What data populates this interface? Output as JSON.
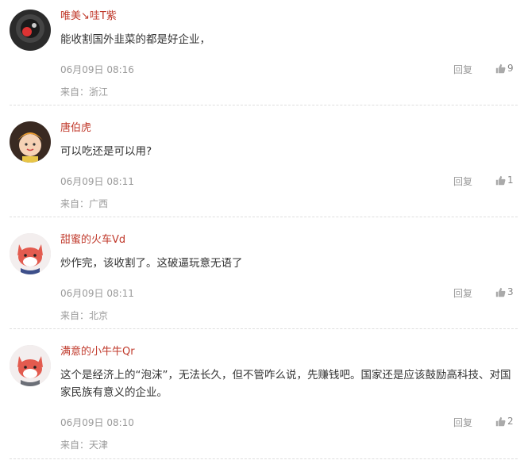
{
  "comments": [
    {
      "username": "唯美↘哇T紫",
      "text": "能收割国外韭菜的都是好企业，",
      "time": "06月09日 08:16",
      "reply_label": "回复",
      "likes": "9",
      "location": "来自：浙江",
      "avatar_icon": "dark-animal-avatar-icon"
    },
    {
      "username": "唐伯虎",
      "text": "可以吃还是可以用?",
      "time": "06月09日 08:11",
      "reply_label": "回复",
      "likes": "1",
      "location": "来自：广西",
      "avatar_icon": "cartoon-boy-avatar-icon"
    },
    {
      "username": "甜蜜的火车Vd",
      "text": "炒作完，该收割了。这破逼玩意无语了",
      "time": "06月09日 08:11",
      "reply_label": "回复",
      "likes": "3",
      "location": "来自：北京",
      "avatar_icon": "red-fox-avatar-icon"
    },
    {
      "username": "满意的小牛牛Qr",
      "text": "这个是经济上的“泡沫”，无法长久，但不管咋么说，先赚钱吧。国家还是应该鼓励高科技、对国家民族有意义的企业。",
      "time": "06月09日 08:10",
      "reply_label": "回复",
      "likes": "2",
      "location": "来自：天津",
      "avatar_icon": "red-fox-avatar-icon"
    }
  ],
  "colors": {
    "username": "#c0392b",
    "text": "#333333",
    "meta": "#9a9a9a"
  }
}
